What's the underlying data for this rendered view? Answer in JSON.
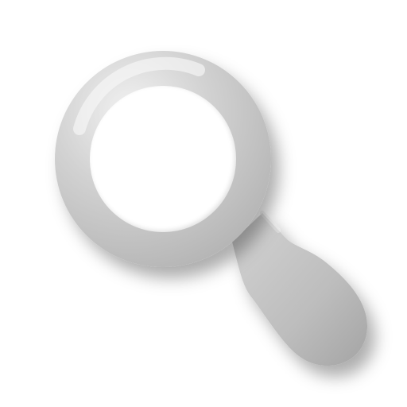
{
  "icon": {
    "name": "search-icon",
    "colors": {
      "background": "#ffffff",
      "metal_light": "#e6e6e6",
      "metal_mid": "#c7c7c7",
      "metal_dark": "#a7a7a7",
      "shadow": "#9a9a9a"
    }
  }
}
